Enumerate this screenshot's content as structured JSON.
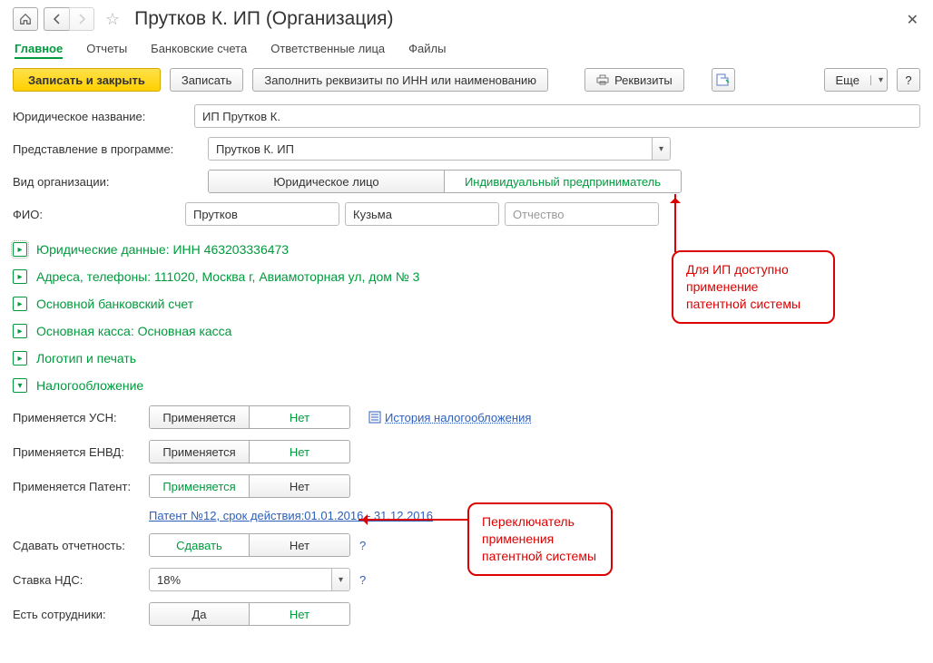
{
  "title": "Прутков К. ИП (Организация)",
  "tabs": [
    "Главное",
    "Отчеты",
    "Банковские счета",
    "Ответственные лица",
    "Файлы"
  ],
  "toolbar": {
    "save_close": "Записать и закрыть",
    "save": "Записать",
    "fill": "Заполнить реквизиты по ИНН или наименованию",
    "requisites": "Реквизиты",
    "more": "Еще"
  },
  "labels": {
    "legal_name": "Юридическое название:",
    "representation": "Представление в программе:",
    "org_type": "Вид организации:",
    "fio": "ФИО:"
  },
  "values": {
    "legal_name": "ИП Прутков К.",
    "representation": "Прутков К. ИП",
    "surname": "Прутков",
    "name": "Кузьма",
    "patronymic_ph": "Отчество"
  },
  "segments": {
    "legal_person": "Юридическое лицо",
    "individual": "Индивидуальный предприниматель"
  },
  "sections": {
    "legal_data": "Юридические данные: ИНН 463203336473",
    "addresses": "Адреса, телефоны: 111020, Москва г, Авиамоторная ул, дом № 3",
    "bank": "Основной банковский счет",
    "cash": "Основная касса: Основная касса",
    "logo": "Логотип и печать",
    "tax": "Налогообложение"
  },
  "tax": {
    "usn_label": "Применяется УСН:",
    "envd_label": "Применяется ЕНВД:",
    "patent_label": "Применяется Патент:",
    "report_label": "Сдавать отчетность:",
    "nds_label": "Ставка НДС:",
    "employees_label": "Есть сотрудники:",
    "apply": "Применяется",
    "no": "Нет",
    "submit": "Сдавать",
    "yes": "Да",
    "nds_value": "18%",
    "history": "История налогообложения",
    "patent_link": "Патент №12, срок действия:01.01.2016 - 31.12.2016"
  },
  "callouts": {
    "c1": "Для ИП доступно применение патентной системы",
    "c2": "Переключатель применения патентной системы"
  }
}
